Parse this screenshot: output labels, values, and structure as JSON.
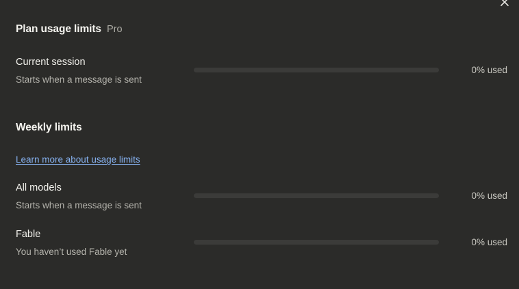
{
  "dialog": {
    "close_icon": "close-icon"
  },
  "plan": {
    "title": "Plan usage limits",
    "badge": "Pro"
  },
  "current_session": {
    "title": "Current session",
    "subtitle": "Starts when a message is sent",
    "value": "0% used",
    "progress_fraction": 0
  },
  "weekly": {
    "title": "Weekly limits",
    "learn_more": "Learn more about usage limits",
    "items": [
      {
        "title": "All models",
        "subtitle": "Starts when a message is sent",
        "value": "0% used",
        "progress_fraction": 0
      },
      {
        "title": "Fable",
        "subtitle": "You haven’t used Fable yet",
        "value": "0% used",
        "progress_fraction": 0
      }
    ]
  },
  "colors": {
    "background": "#2b2b29",
    "track": "#3b3b39",
    "link": "#86b1ef"
  }
}
